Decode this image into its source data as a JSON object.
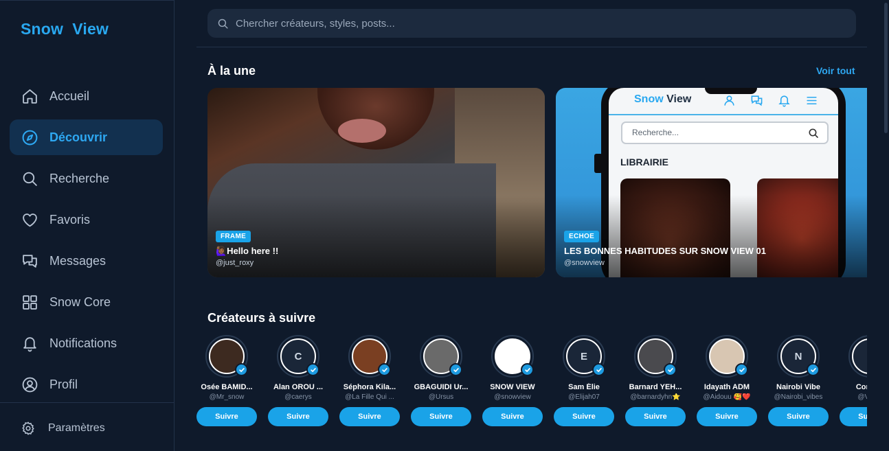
{
  "app": {
    "logo": "Snow  View"
  },
  "sidebar": {
    "items": [
      {
        "label": "Accueil",
        "icon": "home-icon",
        "active": false
      },
      {
        "label": "Découvrir",
        "icon": "compass-icon",
        "active": true
      },
      {
        "label": "Recherche",
        "icon": "search-icon",
        "active": false
      },
      {
        "label": "Favoris",
        "icon": "heart-icon",
        "active": false
      },
      {
        "label": "Messages",
        "icon": "messages-icon",
        "active": false
      },
      {
        "label": "Snow Core",
        "icon": "grid-icon",
        "active": false
      },
      {
        "label": "Notifications",
        "icon": "bell-icon",
        "active": false
      },
      {
        "label": "Profil",
        "icon": "user-icon",
        "active": false
      }
    ],
    "settings_label": "Paramètres"
  },
  "search": {
    "placeholder": "Chercher créateurs, styles, posts..."
  },
  "featured": {
    "title": "À la une",
    "see_all": "Voir tout",
    "cards": [
      {
        "tag": "FRAME",
        "title": "🙋🏾‍♀️Hello here !!",
        "handle": "@just_roxy"
      },
      {
        "tag": "ECHOE",
        "title": "LES BONNES HABITUDES SUR SNOW VIEW 01",
        "handle": "@snowview",
        "mockup": {
          "logo_a": "Snow",
          "logo_b": " View",
          "search": "Recherche...",
          "section": "LIBRAIRIE"
        }
      }
    ]
  },
  "creators": {
    "title": "Créateurs à suivre",
    "follow_label": "Suivre",
    "items": [
      {
        "name": "Osée BAMID...",
        "handle": "@Mr_snow",
        "initial": "",
        "photo": true,
        "photo_color": "#3d2a20"
      },
      {
        "name": "Alan OROU ...",
        "handle": "@caerys",
        "initial": "C",
        "photo": false
      },
      {
        "name": "Séphora Kila...",
        "handle": "@La Fille Qui ...",
        "initial": "",
        "photo": true,
        "photo_color": "#7a3f22"
      },
      {
        "name": "GBAGUIDI Ur...",
        "handle": "@Ursus",
        "initial": "",
        "photo": true,
        "photo_color": "#6a6a6a"
      },
      {
        "name": "SNOW VIEW",
        "handle": "@snowview",
        "initial": "",
        "photo": true,
        "photo_color": "#ffffff"
      },
      {
        "name": "Sam Élie",
        "handle": "@Elijah07",
        "initial": "E",
        "photo": false
      },
      {
        "name": "Barnard YEH...",
        "handle": "@barnardyhn⭐",
        "initial": "",
        "photo": true,
        "photo_color": "#4a4a4e"
      },
      {
        "name": "Idayath ADM",
        "handle": "@Aidouu 🥰❤️",
        "initial": "",
        "photo": true,
        "photo_color": "#d8c6b2"
      },
      {
        "name": "Nairobi Vibe",
        "handle": "@Nairobi_vibes",
        "initial": "N",
        "photo": false
      },
      {
        "name": "Concep",
        "handle": "@Vecto",
        "initial": "",
        "photo": false
      }
    ]
  },
  "colors": {
    "accent": "#1aa3e8",
    "background": "#0f1a2b",
    "active_nav_bg": "#12304f"
  }
}
